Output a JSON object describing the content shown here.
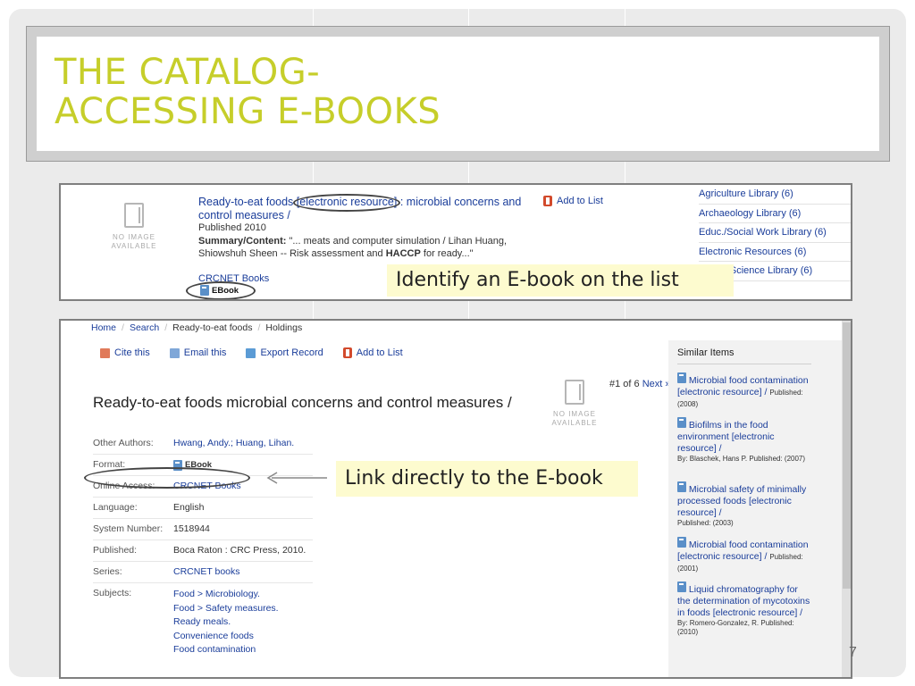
{
  "slide": {
    "title_line1": "THE CATALOG-",
    "title_line2": "ACCESSING E-BOOKS",
    "page_number": "7",
    "accent_color": "#c6ce2a"
  },
  "shot1": {
    "no_image_1": "NO IMAGE",
    "no_image_2": "AVAILABLE",
    "title_a": "Ready-to-eat foods ",
    "title_b": "[electronic resource]",
    "title_c": " : microbial concerns and control measures /",
    "published": "Published 2010",
    "summary_label": "Summary/Content:",
    "summary_a": " \"... meats and computer simulation / Lihan Huang, Shiowshuh Sheen -- Risk assessment and ",
    "summary_bold": "HACCP",
    "summary_b": " for ready...\"",
    "crcnet": "CRCNET Books",
    "ebook": "EBook",
    "add_to_list": "Add to List",
    "facets": [
      "Agriculture Library (6)",
      "Archaeology Library (6)",
      "Educ./Social Work Library (6)",
      "Electronic Resources (6)",
      "Health Science Library (6)"
    ],
    "callout": "Identify an E-book on the list"
  },
  "shot2": {
    "crumbs": [
      "Home",
      "Search",
      "Ready-to-eat foods",
      "Holdings"
    ],
    "toolbar": [
      "Cite this",
      "Email this",
      "Export Record",
      "Add to List"
    ],
    "heading": "Ready-to-eat foods microbial concerns and control measures /",
    "paging_a": "#1 of 6 ",
    "paging_b": "Next »",
    "no_image_1": "NO IMAGE",
    "no_image_2": "AVAILABLE",
    "rows": [
      {
        "k": "Other Authors:",
        "v": "Hwang, Andy.;  Huang, Lihan."
      },
      {
        "k": "Format:",
        "v": "EBook"
      },
      {
        "k": "Online Access:",
        "v": "CRCNET Books"
      },
      {
        "k": "Language:",
        "v": "English"
      },
      {
        "k": "System Number:",
        "v": "1518944"
      },
      {
        "k": "Published:",
        "v": "Boca Raton : CRC Press, 2010."
      },
      {
        "k": "Series:",
        "v": "CRCNET books"
      },
      {
        "k": "Subjects:",
        "v1": "Food > Microbiology.",
        "v2": "Food > Safety measures.",
        "v3": "Ready meals.",
        "v4": "Convenience foods",
        "v5": "Food contamination"
      }
    ],
    "callout": "Link directly to the E-book",
    "similar_head": "Similar Items",
    "similar": [
      {
        "t": "Microbial food contamination [electronic resource] /",
        "m": "Published: (2008)"
      },
      {
        "t": "Biofilms in the food environment [electronic resource] /",
        "m": "By: Blaschek, Hans P. Published: (2007)"
      },
      {
        "t": "Microbial safety of minimally processed foods [electronic resource] /",
        "m": "Published: (2003)"
      },
      {
        "t": "Microbial food contamination [electronic resource] /",
        "m": "Published: (2001)"
      },
      {
        "t": "Liquid chromatography for the determination of mycotoxins in foods [electronic resource] /",
        "m": "By: Romero-Gonzalez, R. Published: (2010)"
      }
    ]
  }
}
